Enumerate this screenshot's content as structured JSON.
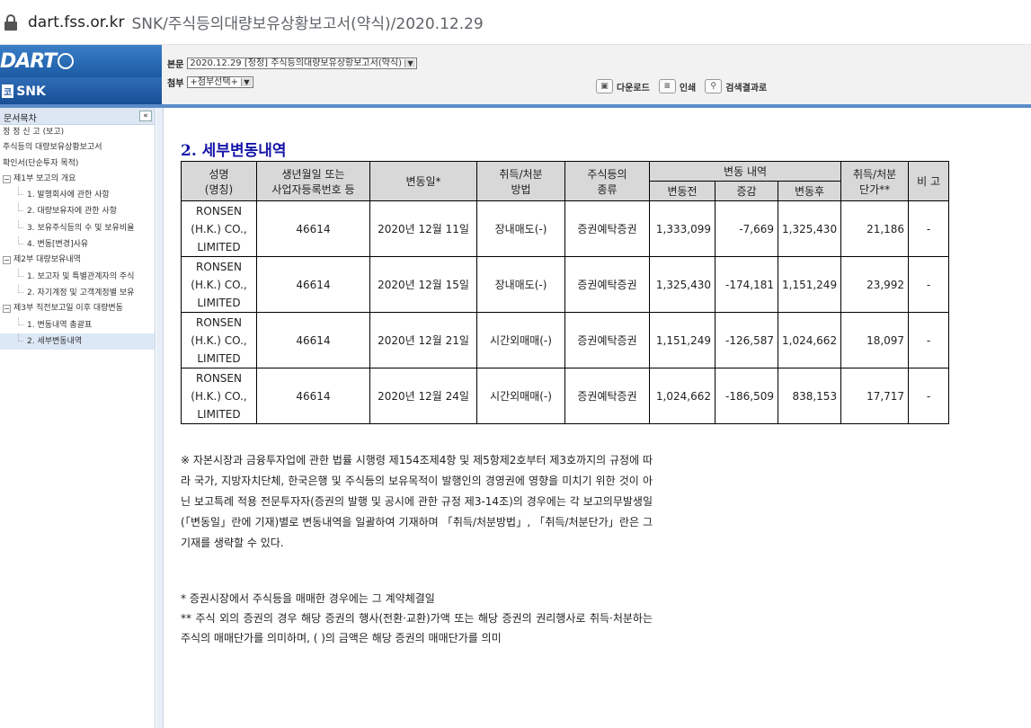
{
  "browser": {
    "host": "dart.fss.or.kr",
    "path": "SNK/주식등의대량보유상황보고서(약식)/2020.12.29"
  },
  "header": {
    "logo_text": "DART",
    "company_prefix": "코",
    "company": "SNK",
    "main_doc_label": "본문",
    "main_doc_value": "2020.12.29  [정정] 주식등의대량보유상황보고서(약식)",
    "attach_label": "첨부",
    "attach_value": "+첨부선택+",
    "download": "다운로드",
    "print": "인쇄",
    "search_results": "검색결과로"
  },
  "sidebar": {
    "title": "문서목차",
    "collapse": "«",
    "items": [
      "정 정 신 고 (보고)",
      "주식등의 대량보유상황보고서",
      "확인서(단순투자 목적)",
      "제1부 보고의 개요",
      "1. 발행회사에 관한 사항",
      "2. 대량보유자에 관한 사항",
      "3. 보유주식등의 수 및 보유비율",
      "4. 변동[변경]사유",
      "제2부 대량보유내역",
      "1. 보고자 및 특별관계자의 주식",
      "2. 자기계정 및 고객계정별 보유",
      "제3부 직전보고일 이후 대량변동",
      "1. 변동내역 총괄표",
      "2. 세부변동내역"
    ]
  },
  "section_title": "2. 세부변동내역",
  "table": {
    "headers": {
      "name": "성명",
      "name2": "(명칭)",
      "birth": "생년월일 또는",
      "birth2": "사업자등록번호 등",
      "date": "변동일*",
      "method": "취득/처분",
      "method2": "방법",
      "type": "주식등의",
      "type2": "종류",
      "change": "변동 내역",
      "before": "변동전",
      "delta": "증감",
      "after": "변동후",
      "price": "취득/처분",
      "price2": "단가**",
      "note": "비 고"
    },
    "rows": [
      {
        "name": "RONSEN (H.K.) CO., LIMITED",
        "id": "46614",
        "date": "2020년 12월 11일",
        "method": "장내매도(-)",
        "type": "증권예탁증권",
        "before": "1,333,099",
        "delta": "-7,669",
        "after": "1,325,430",
        "price": "21,186",
        "note": "-"
      },
      {
        "name": "RONSEN (H.K.) CO., LIMITED",
        "id": "46614",
        "date": "2020년 12월 15일",
        "method": "장내매도(-)",
        "type": "증권예탁증권",
        "before": "1,325,430",
        "delta": "-174,181",
        "after": "1,151,249",
        "price": "23,992",
        "note": "-"
      },
      {
        "name": "RONSEN (H.K.) CO., LIMITED",
        "id": "46614",
        "date": "2020년 12월 21일",
        "method": "시간외매매(-)",
        "type": "증권예탁증권",
        "before": "1,151,249",
        "delta": "-126,587",
        "after": "1,024,662",
        "price": "18,097",
        "note": "-"
      },
      {
        "name": "RONSEN (H.K.) CO., LIMITED",
        "id": "46614",
        "date": "2020년 12월 24일",
        "method": "시간외매매(-)",
        "type": "증권예탁증권",
        "before": "1,024,662",
        "delta": "-186,509",
        "after": "838,153",
        "price": "17,717",
        "note": "-"
      }
    ]
  },
  "notes": {
    "n1": "※ 자본시장과 금융투자업에 관한 법률 시행령 제154조제4항 및 제5항제2호부터 제3호까지의 규정에 따라 국가, 지방자치단체, 한국은행 및 주식등의 보유목적이 발행인의 경영권에 영향을 미치기 위한 것이 아닌 보고특례 적용 전문투자자(증권의 발행 및 공시에 관한 규정 제3-14조)의 경우에는 각 보고의무발생일(「변동일」란에 기재)별로 변동내역을 일괄하여 기재하며 「취득/처분방법」, 「취득/처분단가」란은 그 기재를 생략할 수 있다.",
    "n2": "*    증권시장에서 주식등을 매매한 경우에는 그 계약체결일",
    "n3": "** 주식 외의 증권의 경우 해당 증권의 행사(전환·교환)가액 또는 해당 증권의 권리행사로 취득·처분하는 주식의 매매단가를 의미하며, (    )의 금액은 해당 증권의 매매단가를 의미"
  }
}
